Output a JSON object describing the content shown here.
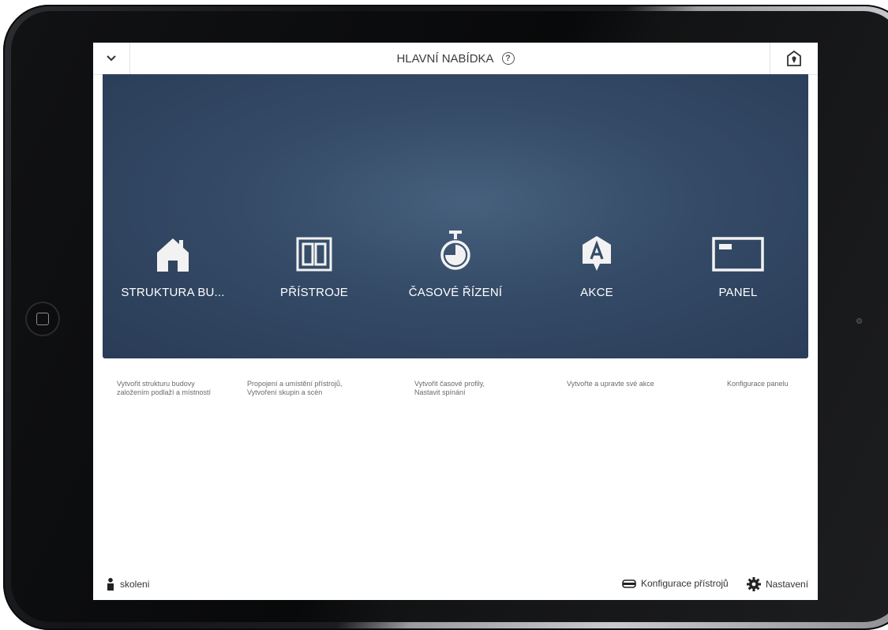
{
  "header": {
    "title": "HLAVNÍ NABÍDKA",
    "help_glyph": "?"
  },
  "tiles": [
    {
      "label": "STRUKTURA BU...",
      "icon": "house-icon",
      "description_lines": [
        "Vytvořit strukturu budovy",
        "založením podlaží a místností"
      ]
    },
    {
      "label": "PŘÍSTROJE",
      "icon": "device-panel-icon",
      "description_lines": [
        "Propojení a umístění přístrojů,",
        "Vytvoření skupin a scén"
      ]
    },
    {
      "label": "ČASOVÉ ŘÍZENÍ",
      "icon": "stopwatch-icon",
      "description_lines": [
        "Vytvořit časové profily,",
        "Nastavit spínání"
      ]
    },
    {
      "label": "AKCE",
      "icon": "action-a-icon",
      "description_lines": [
        "Vytvořte a upravte své akce"
      ]
    },
    {
      "label": "PANEL",
      "icon": "panel-icon",
      "description_lines": [
        "Konfigurace panelu"
      ]
    }
  ],
  "footer": {
    "user": "skoleni",
    "device_config": "Konfigurace přístrojů",
    "settings": "Nastavení"
  },
  "colors": {
    "hero_background": "#344a66",
    "text_primary": "#3c3c3c",
    "text_secondary": "#6a6a6a"
  }
}
